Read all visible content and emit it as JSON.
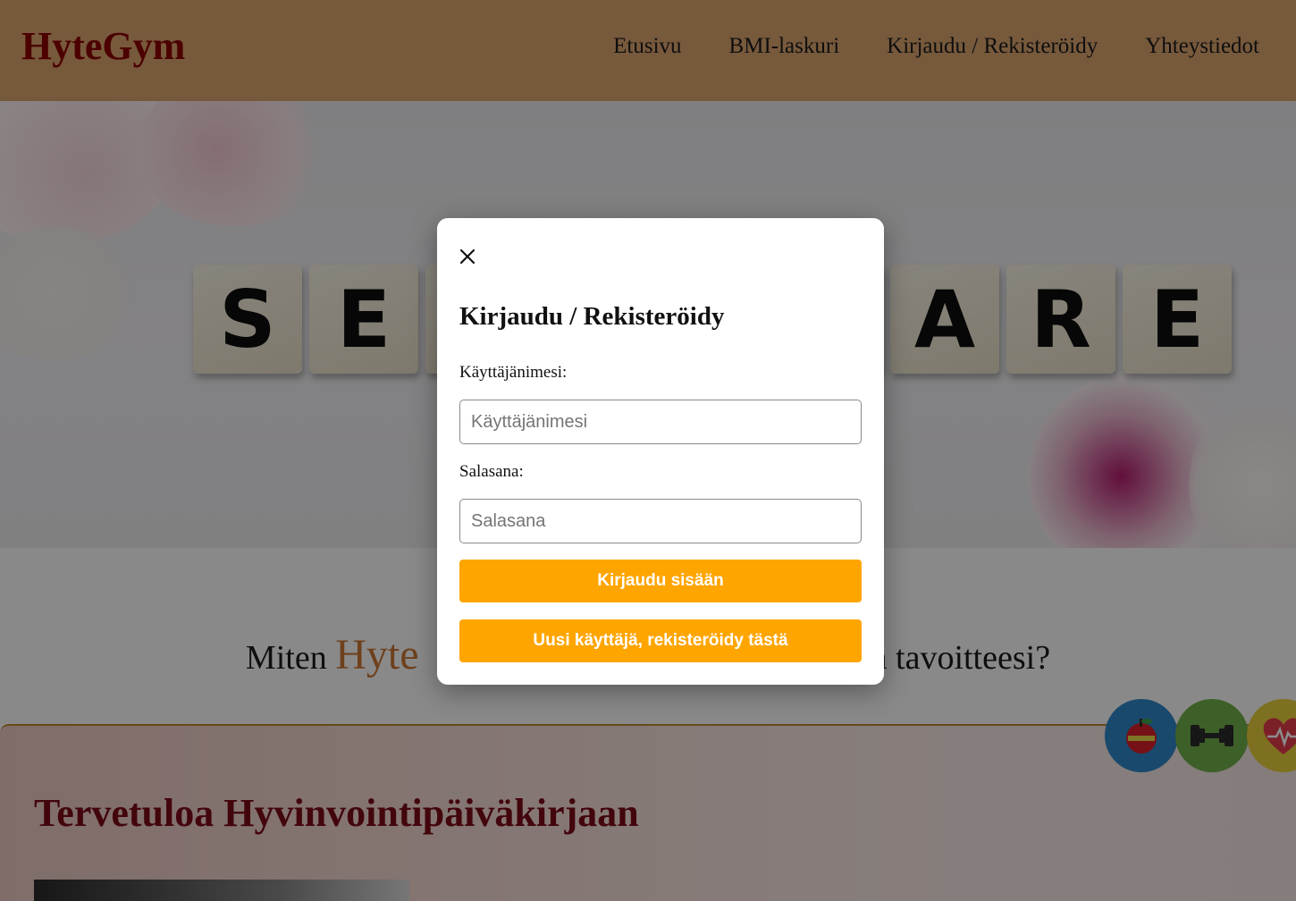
{
  "header": {
    "logo": "HyteGym",
    "nav": [
      "Etusivu",
      "BMI-laskuri",
      "Kirjaudu / Rekisteröidy",
      "Yhteystiedot"
    ]
  },
  "hero": {
    "tiles_left": [
      "S",
      "E"
    ],
    "tiles_right": [
      "R",
      "E"
    ],
    "tile_partial": "A"
  },
  "intro": {
    "prefix": "Miten ",
    "brand": "Hyte",
    "suffix": "n tavoitteesi?"
  },
  "welcome": {
    "title": "Tervetuloa Hyvinvointipäiväkirjaan"
  },
  "modal": {
    "title": "Kirjaudu / Rekisteröidy",
    "username_label": "Käyttäjänimesi:",
    "username_placeholder": "Käyttäjänimesi",
    "password_label": "Salasana:",
    "password_placeholder": "Salasana",
    "login_button": "Kirjaudu sisään",
    "register_button": "Uusi käyttäjä, rekisteröidy tästä"
  },
  "colors": {
    "header_bg": "#d9a36e",
    "logo": "#8b0000",
    "button": "#ffa500",
    "brand_accent": "#c87533",
    "welcome_title": "#7a0a16"
  },
  "icons": [
    "close-icon",
    "apple-icon",
    "dumbbell-icon",
    "heart-icon"
  ]
}
